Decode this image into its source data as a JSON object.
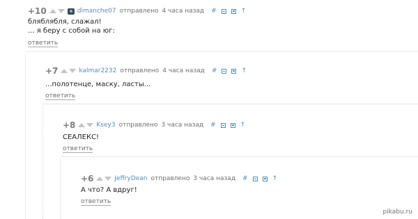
{
  "comments": [
    {
      "rating": "+10",
      "author": "dimanche07",
      "sent_label": "отправлено",
      "time": "4 часа назад",
      "has_avatar": true,
      "lines": [
        "бляблябля, слажал!",
        "... я беру с собой на юг:"
      ],
      "reply_label": "ответить"
    },
    {
      "rating": "+7",
      "author": "kalmar2232",
      "sent_label": "отправлено",
      "time": "4 часа назад",
      "lines": [
        "...полотенце, маску, ласты..."
      ],
      "reply_label": "ответить"
    },
    {
      "rating": "+8",
      "author": "Ksey3",
      "sent_label": "отправлено",
      "time": "3 часа назад",
      "lines": [
        "СЕАЛЕКС!"
      ],
      "reply_label": "ответить"
    },
    {
      "rating": "+6",
      "author": "JeffryDean",
      "sent_label": "отправлено",
      "time": "3 часа назад",
      "lines": [
        "А что? А вдруг!"
      ],
      "reply_label": "ответить"
    }
  ],
  "icons": {
    "hash": "#",
    "arrow_up": "↑"
  },
  "watermark": "pikabu.ru",
  "colors": {
    "link": "#5a8bb5",
    "meta": "#6f6f6f",
    "rating": "#7d7d7d",
    "vote_arrow": "#c4c4c4"
  }
}
